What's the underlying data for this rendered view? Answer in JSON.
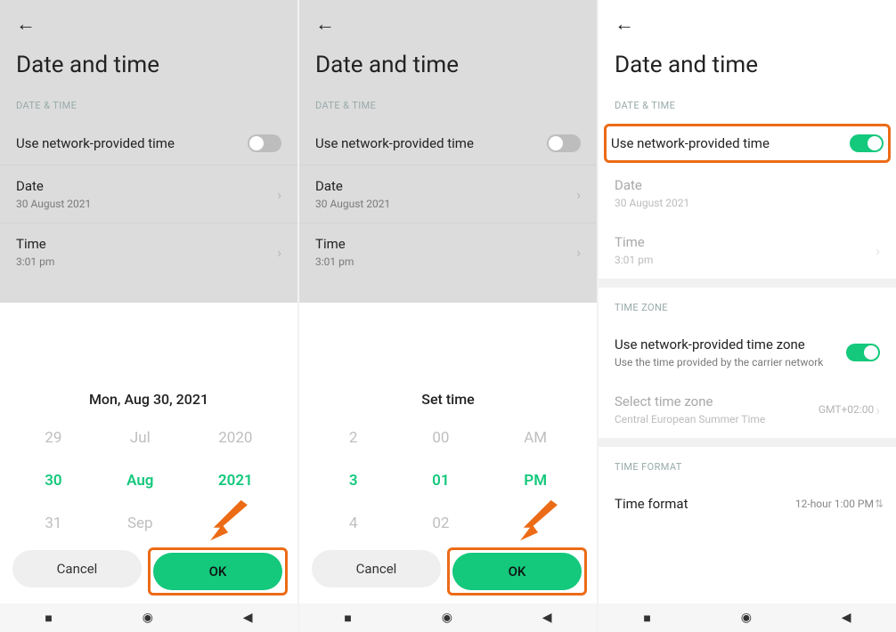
{
  "common": {
    "page_title": "Date and time",
    "section_date_time": "DATE & TIME",
    "use_network_time": "Use network-provided time",
    "date_label": "Date",
    "date_value": "30 August 2021",
    "time_label": "Time",
    "time_value": "3:01 pm",
    "cancel": "Cancel",
    "ok": "OK"
  },
  "s1": {
    "sheet_title": "Mon, Aug 30, 2021",
    "picker": {
      "day": {
        "prev": "29",
        "current": "30",
        "next": "31"
      },
      "month": {
        "prev": "Jul",
        "current": "Aug",
        "next": "Sep"
      },
      "year": {
        "prev": "2020",
        "current": "2021",
        "next": ""
      }
    }
  },
  "s2": {
    "sheet_title": "Set time",
    "picker": {
      "hour": {
        "prev": "2",
        "current": "3",
        "next": "4"
      },
      "minute": {
        "prev": "00",
        "current": "01",
        "next": "02"
      },
      "ampm": {
        "prev": "AM",
        "current": "PM",
        "next": ""
      }
    }
  },
  "s3": {
    "section_time_zone": "TIME ZONE",
    "use_network_tz": "Use network-provided time zone",
    "use_network_tz_sub": "Use the time provided by the carrier network",
    "select_tz": "Select time zone",
    "select_tz_sub": "Central European Summer Time",
    "gmt": "GMT+02:00",
    "section_time_format": "TIME FORMAT",
    "time_format": "Time format",
    "time_format_value": "12-hour 1:00 PM"
  }
}
